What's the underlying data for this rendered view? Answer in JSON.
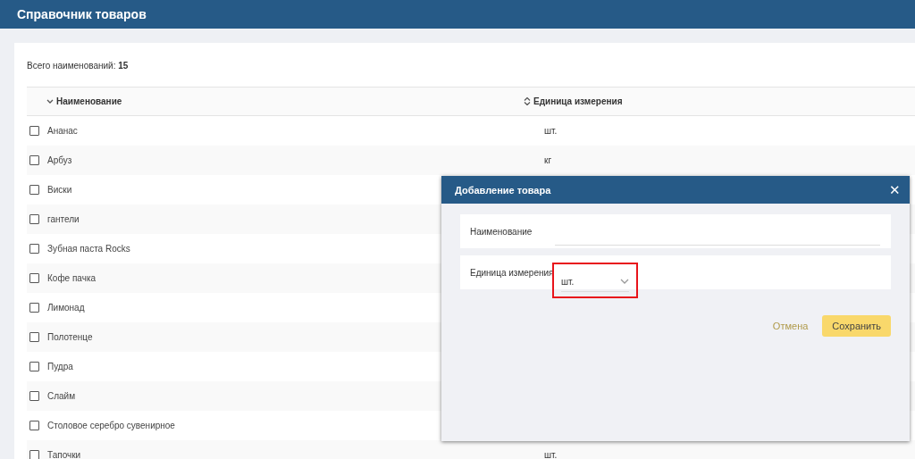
{
  "header": {
    "title": "Справочник товаров"
  },
  "summary": {
    "label": "Всего наименований:",
    "count": "15"
  },
  "table": {
    "columns": [
      {
        "label": "Наименование",
        "sorted": true
      },
      {
        "label": "Единица измерения",
        "sorted": false
      }
    ],
    "rows": [
      {
        "name": "Ананас",
        "unit": "шт.",
        "checked": false
      },
      {
        "name": "Арбуз",
        "unit": "кг",
        "checked": false
      },
      {
        "name": "Виски",
        "checked": false
      },
      {
        "name": "гантели",
        "checked": false
      },
      {
        "name": "Зубная паста Rocks",
        "checked": false
      },
      {
        "name": "Кофе пачка",
        "checked": false
      },
      {
        "name": "Лимонад",
        "checked": false
      },
      {
        "name": "Полотенце",
        "checked": false
      },
      {
        "name": "Пудра",
        "checked": false
      },
      {
        "name": "Слайм",
        "checked": false
      },
      {
        "name": "Столовое серебро сувенирное",
        "checked": false
      },
      {
        "name": "Тапочки",
        "unit": "шт.",
        "checked": false
      }
    ]
  },
  "dialog": {
    "title": "Добавление товара",
    "close": "✕",
    "fields": [
      {
        "kind": "text",
        "label": "Наименование"
      },
      {
        "kind": "select",
        "label": "Единица измерения",
        "value": "шт.",
        "highlighted": true
      }
    ],
    "buttons": [
      {
        "kind": "link",
        "label": "Отмена"
      },
      {
        "kind": "primary",
        "label": "Сохранить"
      }
    ]
  }
}
